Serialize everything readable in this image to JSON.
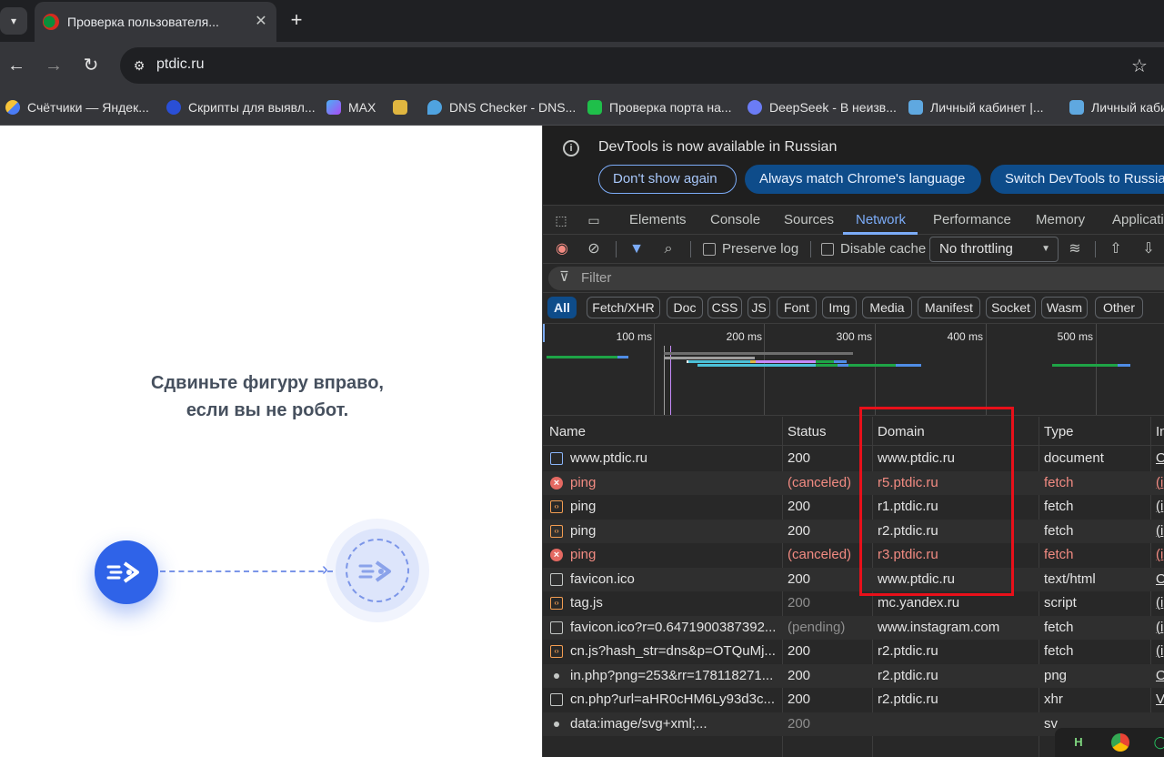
{
  "browser": {
    "tab_title": "Проверка пользователя...",
    "url": "ptdic.ru",
    "bookmarks": [
      {
        "label": "Счётчики — Яндек...",
        "icon": "yandex-metrica-icon",
        "color": "#4a7cf6"
      },
      {
        "label": "Скрипты для выявл...",
        "icon": "scripts-icon",
        "color": "#2a4fd6"
      },
      {
        "label": "MAX",
        "icon": "max-icon",
        "color": "#7b5cf5"
      },
      {
        "label": "",
        "icon": "bookmark-c-icon",
        "color": "#e0b640"
      },
      {
        "label": "DNS Checker - DNS...",
        "icon": "dns-checker-icon",
        "color": "#4fa3e0"
      },
      {
        "label": "Проверка порта на...",
        "icon": "port-check-icon",
        "color": "#1fbf4a"
      },
      {
        "label": "DeepSeek - В неизв...",
        "icon": "deepseek-icon",
        "color": "#6b7cf5"
      },
      {
        "label": "Личный кабинет |...",
        "icon": "cabinet-icon",
        "color": "#5fa8e0"
      },
      {
        "label": "Личный каби",
        "icon": "cabinet-icon",
        "color": "#5fa8e0"
      }
    ]
  },
  "page": {
    "captcha_line1": "Сдвиньте фигуру вправо,",
    "captcha_line2": "если вы не робот."
  },
  "devtools": {
    "infobar": {
      "text": "DevTools is now available in Russian",
      "btn_dont": "Don't show again",
      "btn_match": "Always match Chrome's language",
      "btn_switch": "Switch DevTools to Russian"
    },
    "tabs": [
      "Elements",
      "Console",
      "Sources",
      "Network",
      "Performance",
      "Memory",
      "Application"
    ],
    "active_tab": "Network",
    "toolbar": {
      "preserve_log": "Preserve log",
      "disable_cache": "Disable cache",
      "throttling": "No throttling"
    },
    "filter_placeholder": "Filter",
    "type_filters": [
      "All",
      "Fetch/XHR",
      "Doc",
      "CSS",
      "JS",
      "Font",
      "Img",
      "Media",
      "Manifest",
      "Socket",
      "Wasm",
      "Other"
    ],
    "overview_labels": [
      "100 ms",
      "200 ms",
      "300 ms",
      "400 ms",
      "500 ms"
    ],
    "columns": {
      "name": "Name",
      "status": "Status",
      "domain": "Domain",
      "type": "Type",
      "initiator": "In"
    },
    "requests": [
      {
        "name": "www.ptdic.ru",
        "status": "200",
        "domain": "www.ptdic.ru",
        "type": "document",
        "initiator": "O",
        "icon": "document-icon",
        "error": false
      },
      {
        "name": "ping",
        "status": "(canceled)",
        "domain": "r5.ptdic.ru",
        "type": "fetch",
        "initiator": "(i",
        "icon": "error-icon",
        "error": true
      },
      {
        "name": "ping",
        "status": "200",
        "domain": "r1.ptdic.ru",
        "type": "fetch",
        "initiator": "(i",
        "icon": "fetch-icon",
        "error": false
      },
      {
        "name": "ping",
        "status": "200",
        "domain": "r2.ptdic.ru",
        "type": "fetch",
        "initiator": "(i",
        "icon": "fetch-icon",
        "error": false
      },
      {
        "name": "ping",
        "status": "(canceled)",
        "domain": "r3.ptdic.ru",
        "type": "fetch",
        "initiator": "(i",
        "icon": "error-icon",
        "error": true
      },
      {
        "name": "favicon.ico",
        "status": "200",
        "domain": "www.ptdic.ru",
        "type": "text/html",
        "initiator": "O",
        "icon": "file-icon",
        "error": false
      },
      {
        "name": "tag.js",
        "status": "200",
        "domain": "mc.yandex.ru",
        "type": "script",
        "initiator": "(i",
        "icon": "fetch-icon",
        "error": false,
        "dim_status": true
      },
      {
        "name": "favicon.ico?r=0.6471900387392...",
        "status": "(pending)",
        "domain": "www.instagram.com",
        "type": "fetch",
        "initiator": "(i",
        "icon": "file-icon",
        "error": false,
        "dim_status": true
      },
      {
        "name": "cn.js?hash_str=dns&p=OTQuMj...",
        "status": "200",
        "domain": "r2.ptdic.ru",
        "type": "fetch",
        "initiator": "(i",
        "icon": "fetch-icon",
        "error": false
      },
      {
        "name": "in.php?png=253&rr=178118271...",
        "status": "200",
        "domain": "r2.ptdic.ru",
        "type": "png",
        "initiator": "O",
        "icon": "dot-icon",
        "error": false
      },
      {
        "name": "cn.php?url=aHR0cHM6Ly93d3c...",
        "status": "200",
        "domain": "r2.ptdic.ru",
        "type": "xhr",
        "initiator": "V",
        "icon": "file-icon",
        "error": false
      },
      {
        "name": "data:image/svg+xml;...",
        "status": "200",
        "domain": "",
        "type": "sv",
        "initiator": "",
        "icon": "dot-icon",
        "error": false,
        "dim_status": true
      }
    ]
  },
  "colors": {
    "accent_blue": "#7cacf8",
    "error_red": "#f28b82",
    "highlight_red": "#e8101a",
    "captcha_blue": "#2f63e8"
  }
}
